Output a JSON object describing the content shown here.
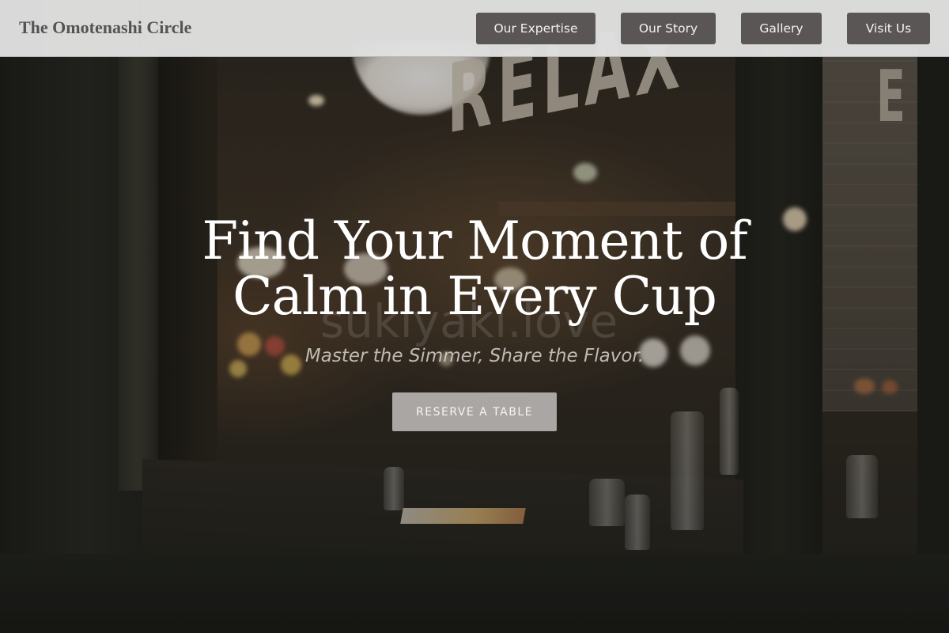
{
  "header": {
    "logo_text": "The Omotenashi Circle",
    "nav": [
      {
        "label": "Our Expertise"
      },
      {
        "label": "Our Story"
      },
      {
        "label": "Gallery"
      },
      {
        "label": "Visit Us"
      }
    ]
  },
  "hero": {
    "title_line1": "Find Your Moment of",
    "title_line2": "Calm in Every Cup",
    "subtitle": "Master the Simmer, Share the Flavor.",
    "cta_label": "RESERVE A TABLE",
    "background": {
      "sign_text": "RELAX",
      "sign_text_partial": "E",
      "watermark_text": "sukiyaki.love"
    }
  },
  "colors": {
    "header_bg": "#e0e0e0",
    "nav_button_bg": "#595655",
    "nav_button_text": "#f4f2f0",
    "logo_text": "#555353",
    "cta_bg": "#a9a6a3",
    "hero_title": "#ffffff"
  }
}
